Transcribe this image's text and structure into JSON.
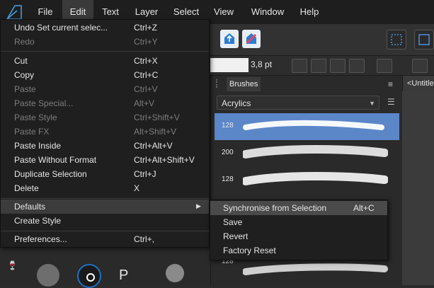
{
  "app": {
    "logo_icon": "affinity-logo-icon"
  },
  "menubar": {
    "items": [
      "File",
      "Edit",
      "Text",
      "Layer",
      "Select",
      "View",
      "Window",
      "Help"
    ]
  },
  "context_bar": {
    "stroke_value": "3,8 pt"
  },
  "brushes_panel": {
    "tab_label": "Brushes",
    "category": "Acrylics",
    "brushes": [
      {
        "size": "128",
        "selected": true
      },
      {
        "size": "200",
        "selected": false
      },
      {
        "size": "128",
        "selected": false
      },
      {
        "size": "128",
        "selected": false
      }
    ]
  },
  "document_tab": {
    "label": "<Untitled"
  },
  "edit_menu": {
    "items": [
      {
        "label": "Undo Set current selec...",
        "shortcut": "Ctrl+Z",
        "enabled": true
      },
      {
        "label": "Redo",
        "shortcut": "Ctrl+Y",
        "enabled": false
      },
      {
        "label": "Cut",
        "shortcut": "Ctrl+X",
        "enabled": true
      },
      {
        "label": "Copy",
        "shortcut": "Ctrl+C",
        "enabled": true
      },
      {
        "label": "Paste",
        "shortcut": "Ctrl+V",
        "enabled": false
      },
      {
        "label": "Paste Special...",
        "shortcut": "Alt+V",
        "enabled": false
      },
      {
        "label": "Paste Style",
        "shortcut": "Ctrl+Shift+V",
        "enabled": false
      },
      {
        "label": "Paste FX",
        "shortcut": "Alt+Shift+V",
        "enabled": false
      },
      {
        "label": "Paste Inside",
        "shortcut": "Ctrl+Alt+V",
        "enabled": true
      },
      {
        "label": "Paste Without Format",
        "shortcut": "Ctrl+Alt+Shift+V",
        "enabled": true
      },
      {
        "label": "Duplicate Selection",
        "shortcut": "Ctrl+J",
        "enabled": true
      },
      {
        "label": "Delete",
        "shortcut": "X",
        "enabled": true
      },
      {
        "label": "Defaults",
        "shortcut": "",
        "enabled": true
      },
      {
        "label": "Create Style",
        "shortcut": "",
        "enabled": true
      },
      {
        "label": "Preferences...",
        "shortcut": "Ctrl+,",
        "enabled": true
      }
    ]
  },
  "defaults_submenu": {
    "items": [
      {
        "label": "Synchronise from Selection",
        "shortcut": "Alt+C"
      },
      {
        "label": "Save",
        "shortcut": ""
      },
      {
        "label": "Revert",
        "shortcut": ""
      },
      {
        "label": "Factory Reset",
        "shortcut": ""
      }
    ]
  },
  "colors": {
    "selected_brush_bg": "#5b87c9",
    "menu_bg": "#1f1f1f",
    "accent_blue": "#4a90d9"
  }
}
